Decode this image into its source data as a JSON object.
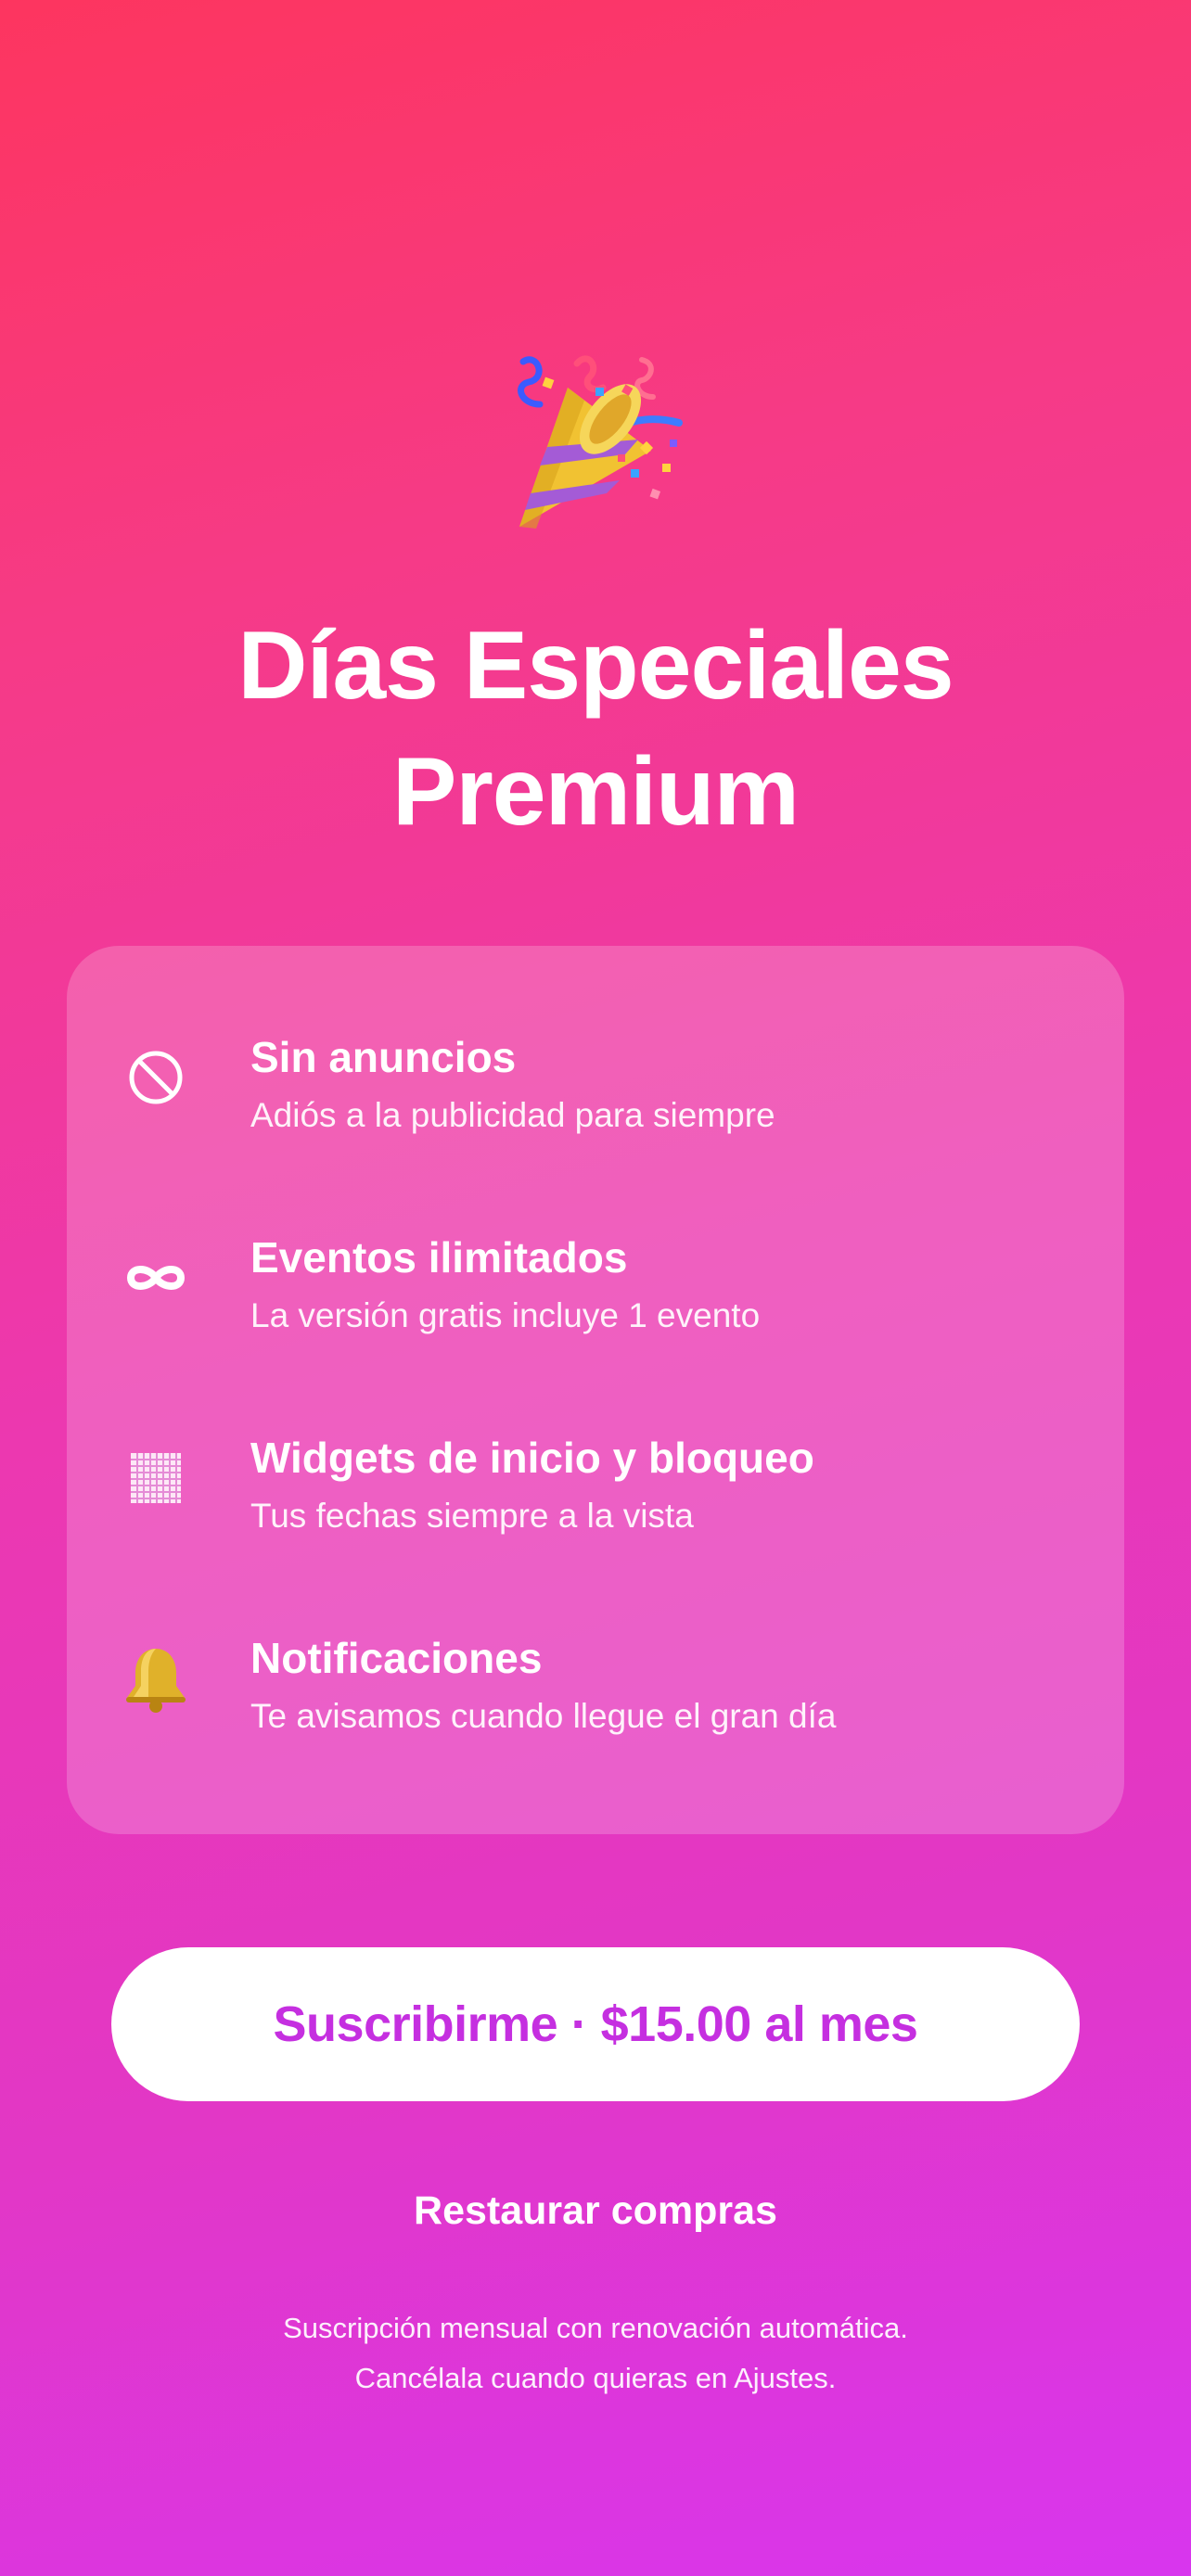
{
  "hero": {
    "icon": "party-popper-icon"
  },
  "title": {
    "line1": "Días Especiales",
    "line2": "Premium"
  },
  "features": [
    {
      "icon": "no-entry-icon",
      "title": "Sin anuncios",
      "description": "Adiós a la publicidad para siempre"
    },
    {
      "icon": "infinity-icon",
      "title": "Eventos ilimitados",
      "description": "La versión gratis incluye 1 evento"
    },
    {
      "icon": "widget-grid-icon",
      "title": "Widgets de inicio y bloqueo",
      "description": "Tus fechas siempre a la vista"
    },
    {
      "icon": "bell-icon",
      "title": "Notificaciones",
      "description": "Te avisamos cuando llegue el gran día"
    }
  ],
  "cta": {
    "label": "Suscribirme · $15.00 al mes"
  },
  "restore": {
    "label": "Restaurar compras"
  },
  "fine_print": {
    "line1": "Suscripción mensual con renovación automática.",
    "line2": "Cancélala cuando quieras en Ajustes."
  },
  "colors": {
    "gradient_top": "#fd355f",
    "gradient_bottom": "#d836ee",
    "cta_text": "#c52fe0",
    "cta_background": "#ffffff"
  }
}
